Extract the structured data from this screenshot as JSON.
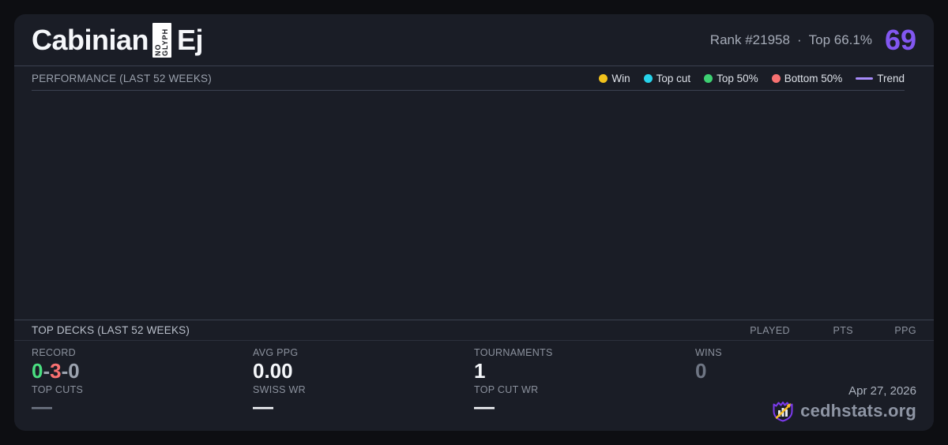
{
  "header": {
    "title_prefix": "Cabinian",
    "title_noglyph": "NO GLYPH",
    "title_suffix": "Ej",
    "rank": "Rank #21958",
    "separator": "·",
    "percentile": "Top 66.1%",
    "score": "69"
  },
  "performance": {
    "heading": "PERFORMANCE (LAST 52 WEEKS)",
    "legend": [
      {
        "label": "Win",
        "color": "#f2c21c",
        "swatch": "dot"
      },
      {
        "label": "Top cut",
        "color": "#27d3ea",
        "swatch": "dot"
      },
      {
        "label": "Top 50%",
        "color": "#3dd072",
        "swatch": "dot"
      },
      {
        "label": "Bottom 50%",
        "color": "#f87171",
        "swatch": "dot"
      },
      {
        "label": "Trend",
        "color": "#a78bfa",
        "swatch": "line"
      }
    ]
  },
  "chart_data": {
    "type": "scatter",
    "title": "PERFORMANCE (LAST 52 WEEKS)",
    "series": [],
    "note": "plot area is empty - no events rendered in the last 52 weeks window"
  },
  "top_decks": {
    "heading": "TOP DECKS (LAST 52 WEEKS)",
    "columns": [
      "PLAYED",
      "PTS",
      "PPG"
    ],
    "rows": []
  },
  "stats": {
    "record": {
      "label": "RECORD",
      "wins": "0",
      "losses": "3",
      "draws": "0",
      "separator": "-"
    },
    "avg_ppg": {
      "label": "AVG PPG",
      "value": "0.00"
    },
    "tournaments": {
      "label": "TOURNAMENTS",
      "value": "1"
    },
    "wins": {
      "label": "WINS",
      "value": "0"
    },
    "top_cuts": {
      "label": "TOP CUTS",
      "value": "—"
    },
    "swiss_wr": {
      "label": "SWISS WR",
      "value": "—"
    },
    "top_cut_wr": {
      "label": "TOP CUT WR",
      "value": "—"
    }
  },
  "footer": {
    "date": "Apr 27, 2026",
    "brand": "cedhstats.org"
  },
  "colors": {
    "accent_purple": "#8257f0",
    "record_win": "#4ade80",
    "record_loss": "#f87171",
    "record_draw": "#9ca3af",
    "wins_muted": "#6f7684",
    "logo_shield": "#7c3aed",
    "logo_bars": "#e8eaf0",
    "logo_arrow": "#fbbf24"
  }
}
